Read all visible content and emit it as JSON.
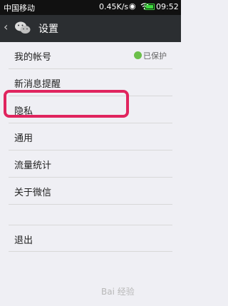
{
  "status_bar": {
    "carrier": "中国移动",
    "speed": "0.45K/s",
    "time": "09:52",
    "icons": [
      "eye-icon",
      "wifi-icon",
      "battery-icon"
    ]
  },
  "app_bar": {
    "back_icon": "chevron-left-icon",
    "logo_icon": "wechat-logo-icon",
    "title": "设置"
  },
  "settings": {
    "items": [
      {
        "label": "我的帐号",
        "status": "已保护"
      },
      {
        "label": "新消息提醒"
      },
      {
        "label": "隐私"
      },
      {
        "label": "通用"
      },
      {
        "label": "流量统计"
      },
      {
        "label": "关于微信"
      },
      {
        "label": "退出"
      }
    ]
  },
  "highlight": {
    "color": "#e0245e"
  },
  "watermark": "Bai 经验"
}
